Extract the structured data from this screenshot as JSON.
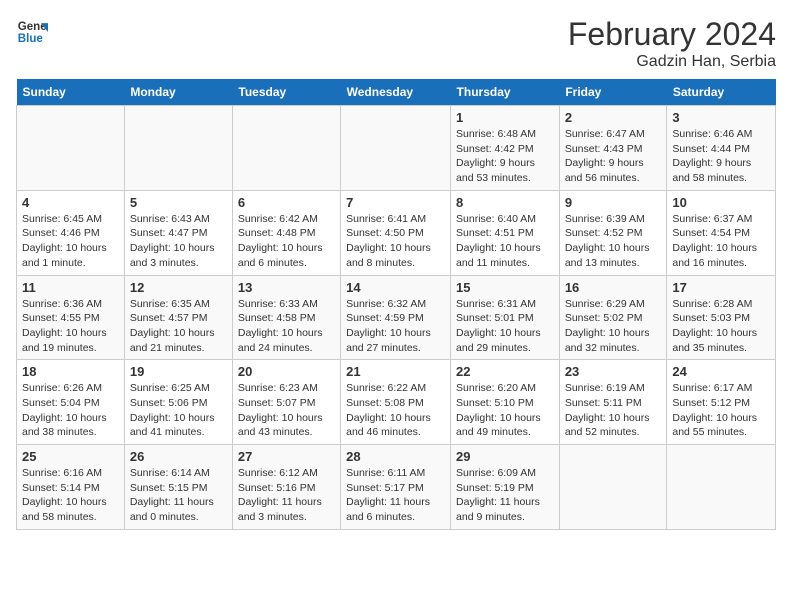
{
  "header": {
    "logo_line1": "General",
    "logo_line2": "Blue",
    "title": "February 2024",
    "subtitle": "Gadzin Han, Serbia"
  },
  "days_of_week": [
    "Sunday",
    "Monday",
    "Tuesday",
    "Wednesday",
    "Thursday",
    "Friday",
    "Saturday"
  ],
  "weeks": [
    [
      {
        "num": "",
        "info": ""
      },
      {
        "num": "",
        "info": ""
      },
      {
        "num": "",
        "info": ""
      },
      {
        "num": "",
        "info": ""
      },
      {
        "num": "1",
        "info": "Sunrise: 6:48 AM\nSunset: 4:42 PM\nDaylight: 9 hours\nand 53 minutes."
      },
      {
        "num": "2",
        "info": "Sunrise: 6:47 AM\nSunset: 4:43 PM\nDaylight: 9 hours\nand 56 minutes."
      },
      {
        "num": "3",
        "info": "Sunrise: 6:46 AM\nSunset: 4:44 PM\nDaylight: 9 hours\nand 58 minutes."
      }
    ],
    [
      {
        "num": "4",
        "info": "Sunrise: 6:45 AM\nSunset: 4:46 PM\nDaylight: 10 hours\nand 1 minute."
      },
      {
        "num": "5",
        "info": "Sunrise: 6:43 AM\nSunset: 4:47 PM\nDaylight: 10 hours\nand 3 minutes."
      },
      {
        "num": "6",
        "info": "Sunrise: 6:42 AM\nSunset: 4:48 PM\nDaylight: 10 hours\nand 6 minutes."
      },
      {
        "num": "7",
        "info": "Sunrise: 6:41 AM\nSunset: 4:50 PM\nDaylight: 10 hours\nand 8 minutes."
      },
      {
        "num": "8",
        "info": "Sunrise: 6:40 AM\nSunset: 4:51 PM\nDaylight: 10 hours\nand 11 minutes."
      },
      {
        "num": "9",
        "info": "Sunrise: 6:39 AM\nSunset: 4:52 PM\nDaylight: 10 hours\nand 13 minutes."
      },
      {
        "num": "10",
        "info": "Sunrise: 6:37 AM\nSunset: 4:54 PM\nDaylight: 10 hours\nand 16 minutes."
      }
    ],
    [
      {
        "num": "11",
        "info": "Sunrise: 6:36 AM\nSunset: 4:55 PM\nDaylight: 10 hours\nand 19 minutes."
      },
      {
        "num": "12",
        "info": "Sunrise: 6:35 AM\nSunset: 4:57 PM\nDaylight: 10 hours\nand 21 minutes."
      },
      {
        "num": "13",
        "info": "Sunrise: 6:33 AM\nSunset: 4:58 PM\nDaylight: 10 hours\nand 24 minutes."
      },
      {
        "num": "14",
        "info": "Sunrise: 6:32 AM\nSunset: 4:59 PM\nDaylight: 10 hours\nand 27 minutes."
      },
      {
        "num": "15",
        "info": "Sunrise: 6:31 AM\nSunset: 5:01 PM\nDaylight: 10 hours\nand 29 minutes."
      },
      {
        "num": "16",
        "info": "Sunrise: 6:29 AM\nSunset: 5:02 PM\nDaylight: 10 hours\nand 32 minutes."
      },
      {
        "num": "17",
        "info": "Sunrise: 6:28 AM\nSunset: 5:03 PM\nDaylight: 10 hours\nand 35 minutes."
      }
    ],
    [
      {
        "num": "18",
        "info": "Sunrise: 6:26 AM\nSunset: 5:04 PM\nDaylight: 10 hours\nand 38 minutes."
      },
      {
        "num": "19",
        "info": "Sunrise: 6:25 AM\nSunset: 5:06 PM\nDaylight: 10 hours\nand 41 minutes."
      },
      {
        "num": "20",
        "info": "Sunrise: 6:23 AM\nSunset: 5:07 PM\nDaylight: 10 hours\nand 43 minutes."
      },
      {
        "num": "21",
        "info": "Sunrise: 6:22 AM\nSunset: 5:08 PM\nDaylight: 10 hours\nand 46 minutes."
      },
      {
        "num": "22",
        "info": "Sunrise: 6:20 AM\nSunset: 5:10 PM\nDaylight: 10 hours\nand 49 minutes."
      },
      {
        "num": "23",
        "info": "Sunrise: 6:19 AM\nSunset: 5:11 PM\nDaylight: 10 hours\nand 52 minutes."
      },
      {
        "num": "24",
        "info": "Sunrise: 6:17 AM\nSunset: 5:12 PM\nDaylight: 10 hours\nand 55 minutes."
      }
    ],
    [
      {
        "num": "25",
        "info": "Sunrise: 6:16 AM\nSunset: 5:14 PM\nDaylight: 10 hours\nand 58 minutes."
      },
      {
        "num": "26",
        "info": "Sunrise: 6:14 AM\nSunset: 5:15 PM\nDaylight: 11 hours\nand 0 minutes."
      },
      {
        "num": "27",
        "info": "Sunrise: 6:12 AM\nSunset: 5:16 PM\nDaylight: 11 hours\nand 3 minutes."
      },
      {
        "num": "28",
        "info": "Sunrise: 6:11 AM\nSunset: 5:17 PM\nDaylight: 11 hours\nand 6 minutes."
      },
      {
        "num": "29",
        "info": "Sunrise: 6:09 AM\nSunset: 5:19 PM\nDaylight: 11 hours\nand 9 minutes."
      },
      {
        "num": "",
        "info": ""
      },
      {
        "num": "",
        "info": ""
      }
    ]
  ]
}
